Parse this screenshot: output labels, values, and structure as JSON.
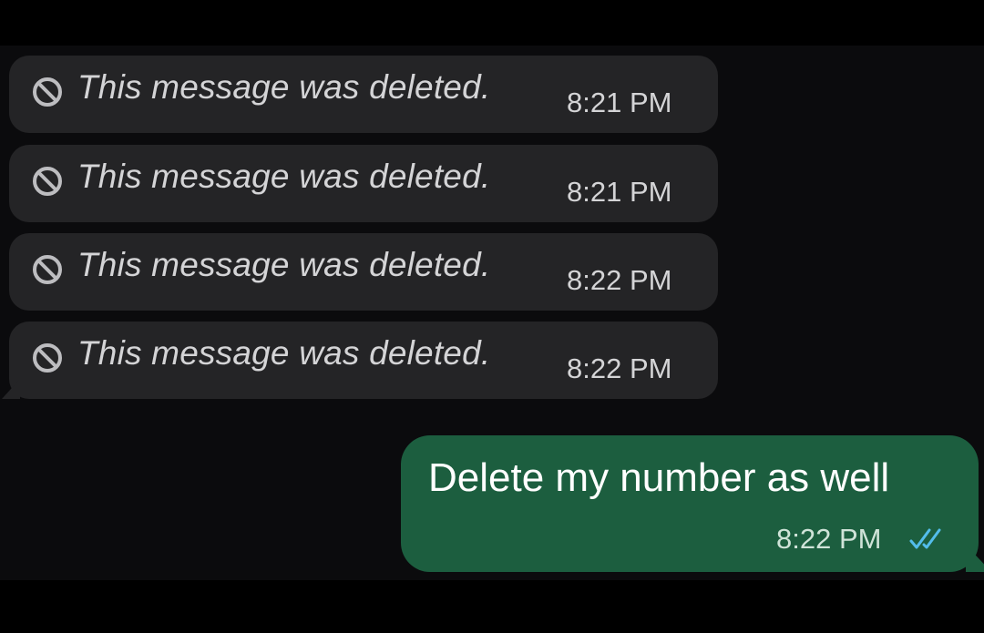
{
  "colors": {
    "background": "#000000",
    "chat_background": "#0b0b0d",
    "incoming_bubble": "#242426",
    "outgoing_bubble": "#1c5e3f",
    "read_ticks": "#53bdeb"
  },
  "messages": [
    {
      "type": "deleted",
      "icon": "blocked-circle-icon",
      "text": "This message was deleted.",
      "time": "8:21 PM"
    },
    {
      "type": "deleted",
      "icon": "blocked-circle-icon",
      "text": "This message was deleted.",
      "time": "8:21 PM"
    },
    {
      "type": "deleted",
      "icon": "blocked-circle-icon",
      "text": "This message was deleted.",
      "time": "8:22 PM"
    },
    {
      "type": "deleted",
      "icon": "blocked-circle-icon",
      "text": "This message was deleted.",
      "time": "8:22 PM"
    }
  ],
  "outgoing": {
    "text": "Delete my number as well",
    "time": "8:22 PM",
    "status_icon": "double-check-icon",
    "status": "read"
  }
}
